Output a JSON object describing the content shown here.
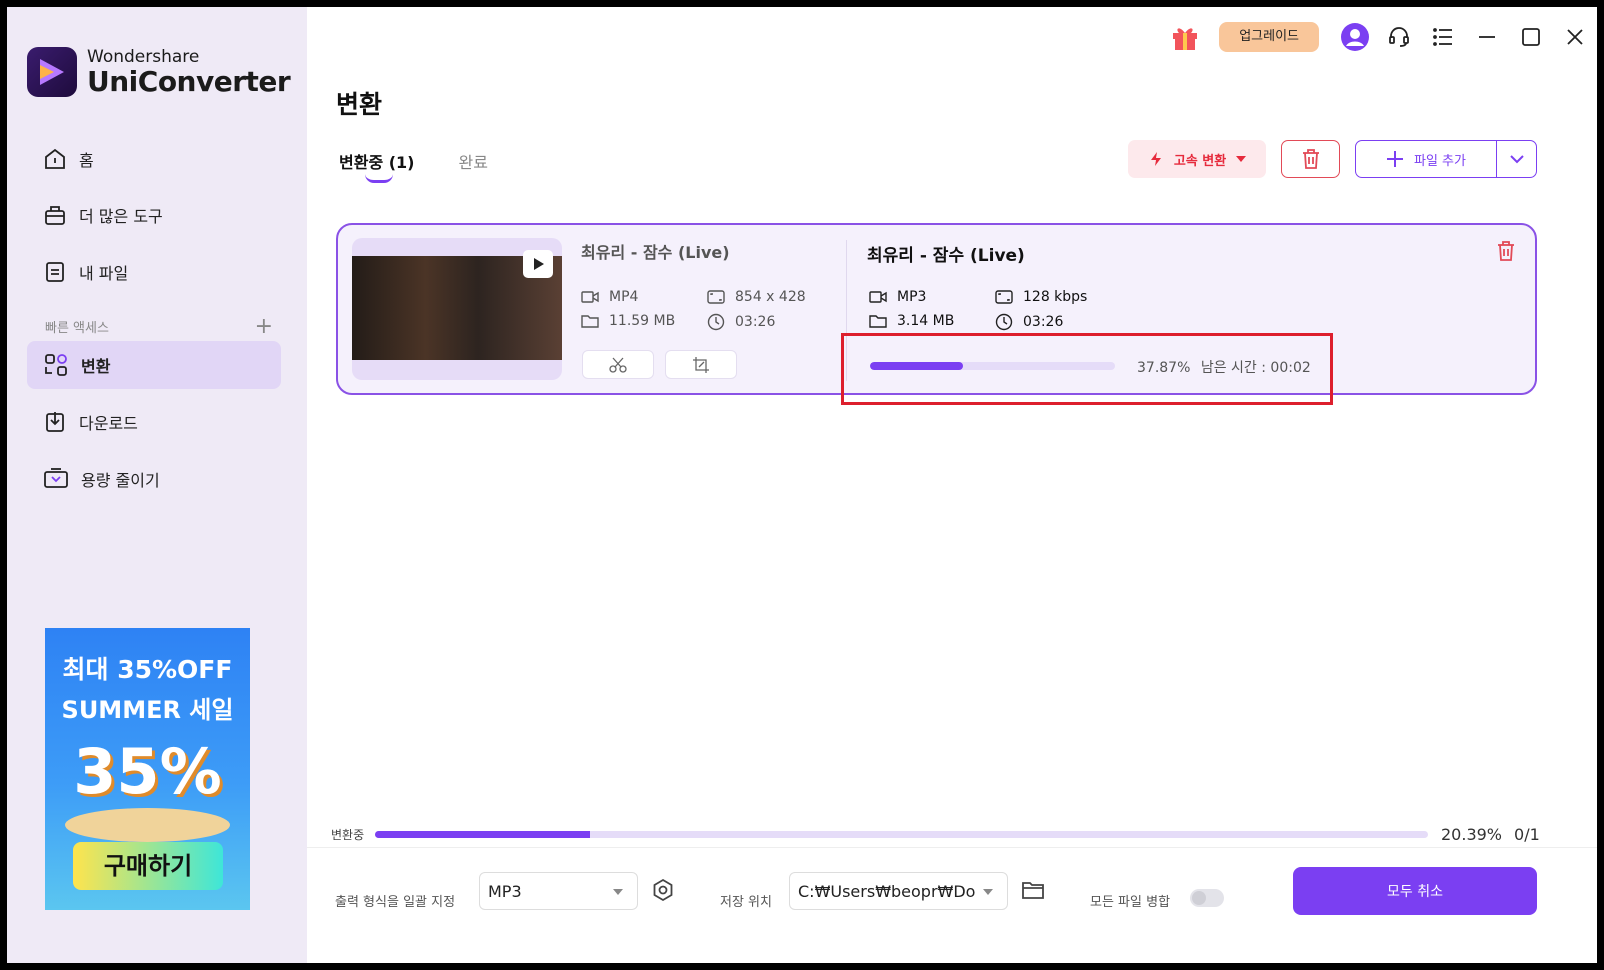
{
  "app": {
    "brand": "Wondershare",
    "product": "UniConverter"
  },
  "topbar": {
    "upgrade_label": "업그레이드"
  },
  "sidebar": {
    "items": [
      {
        "label": "홈",
        "icon": "home-icon"
      },
      {
        "label": "더 많은 도구",
        "icon": "toolbox-icon"
      },
      {
        "label": "내 파일",
        "icon": "file-icon"
      },
      {
        "label": "변환",
        "icon": "convert-icon",
        "active": true
      },
      {
        "label": "다운로드",
        "icon": "download-icon"
      },
      {
        "label": "용량 줄이기",
        "icon": "compress-icon"
      }
    ],
    "quick_access_label": "빠른 액세스",
    "quick_access_add": "+",
    "promo": {
      "line1": "최대 35%OFF",
      "line2": "SUMMER 세일",
      "big": "35%",
      "button": "구매하기"
    }
  },
  "main": {
    "title": "변환",
    "tabs": [
      {
        "label": "변환중 (1)",
        "active": true
      },
      {
        "label": "완료",
        "active": false
      }
    ],
    "actions": {
      "fast_convert": "고속 변환",
      "add_file": "파일 추가"
    }
  },
  "task": {
    "source": {
      "name": "최유리 - 잠수 (Live)",
      "format": "MP4",
      "resolution": "854 x 428",
      "size": "11.59 MB",
      "duration": "03:26"
    },
    "output": {
      "name": "최유리 - 잠수 (Live)",
      "format": "MP3",
      "bitrate": "128 kbps",
      "size": "3.14 MB",
      "duration": "03:26"
    },
    "progress_percent": 37.87,
    "progress_label": "37.87%",
    "remaining": "남은 시간 : 00:02"
  },
  "overall": {
    "label": "변환중",
    "percent": 20.39,
    "percent_label": "20.39%",
    "count": "0/1"
  },
  "footer": {
    "output_format_label": "출력 형식을 일괄 지정",
    "output_format_value": "MP3",
    "save_location_label": "저장 위치",
    "save_location_value": "C:₩Users₩beopr₩Dow",
    "merge_label": "모든 파일 병합",
    "merge_enabled": false,
    "cancel_all": "모두 취소"
  },
  "colors": {
    "accent": "#7b3ff2",
    "sidebar_bg": "#efeaf6",
    "danger": "#e24a57",
    "highlight": "#dd1f2d"
  }
}
